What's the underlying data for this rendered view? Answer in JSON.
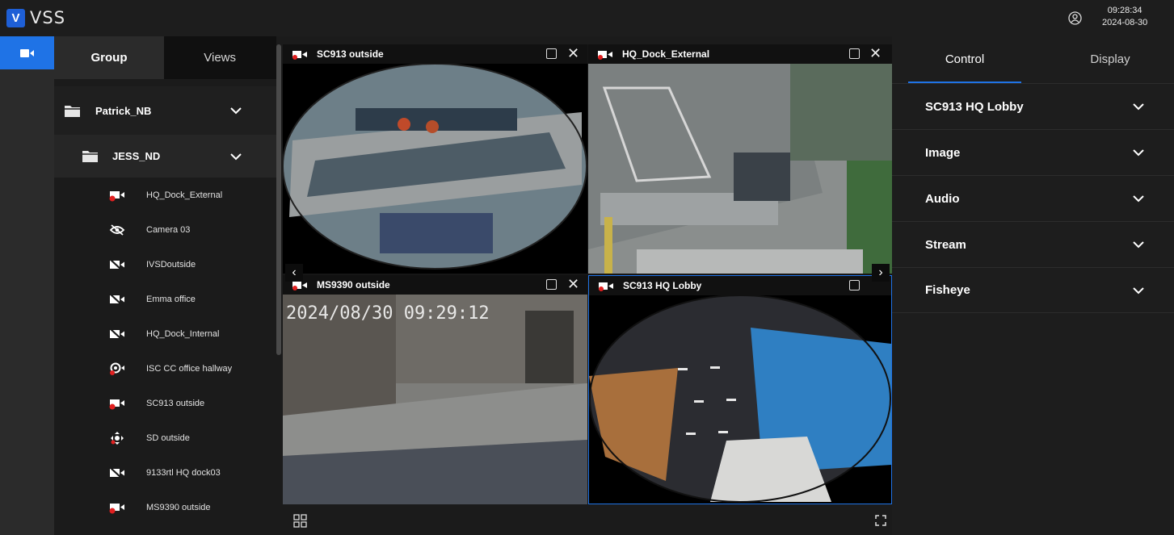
{
  "app": {
    "logo_letter": "V",
    "name": "VSS"
  },
  "clock": {
    "time": "09:28:34",
    "date": "2024-08-30"
  },
  "tree": {
    "tabs": [
      "Group",
      "Views"
    ],
    "groups": [
      {
        "label": "Patrick_NB"
      },
      {
        "label": "JESS_ND"
      }
    ],
    "cameras": [
      {
        "label": "HQ_Dock_External",
        "icon": "camera-recording-icon"
      },
      {
        "label": "Camera 03",
        "icon": "eye-off-icon"
      },
      {
        "label": "IVSDoutside",
        "icon": "camera-offline-icon"
      },
      {
        "label": "Emma office",
        "icon": "camera-offline-icon"
      },
      {
        "label": "HQ_Dock_Internal",
        "icon": "camera-offline-icon"
      },
      {
        "label": "ISC CC office hallway",
        "icon": "eye-camera-icon"
      },
      {
        "label": "SC913 outside",
        "icon": "camera-recording-icon"
      },
      {
        "label": "SD outside",
        "icon": "ptz-icon"
      },
      {
        "label": "9133rtl HQ dock03",
        "icon": "camera-offline-icon"
      },
      {
        "label": "MS9390 outside",
        "icon": "camera-recording-icon"
      }
    ]
  },
  "tiles": [
    {
      "title": "SC913 outside"
    },
    {
      "title": "HQ_Dock_External"
    },
    {
      "title": "MS9390 outside",
      "overlay": "2024/08/30 09:29:12"
    },
    {
      "title": "SC913 HQ Lobby"
    }
  ],
  "control": {
    "tabs": [
      "Control",
      "Display"
    ],
    "sections": [
      "SC913 HQ Lobby",
      "Image",
      "Audio",
      "Stream",
      "Fisheye"
    ]
  },
  "colors": {
    "accent": "#1f73e6",
    "record_red": "#e02020"
  }
}
